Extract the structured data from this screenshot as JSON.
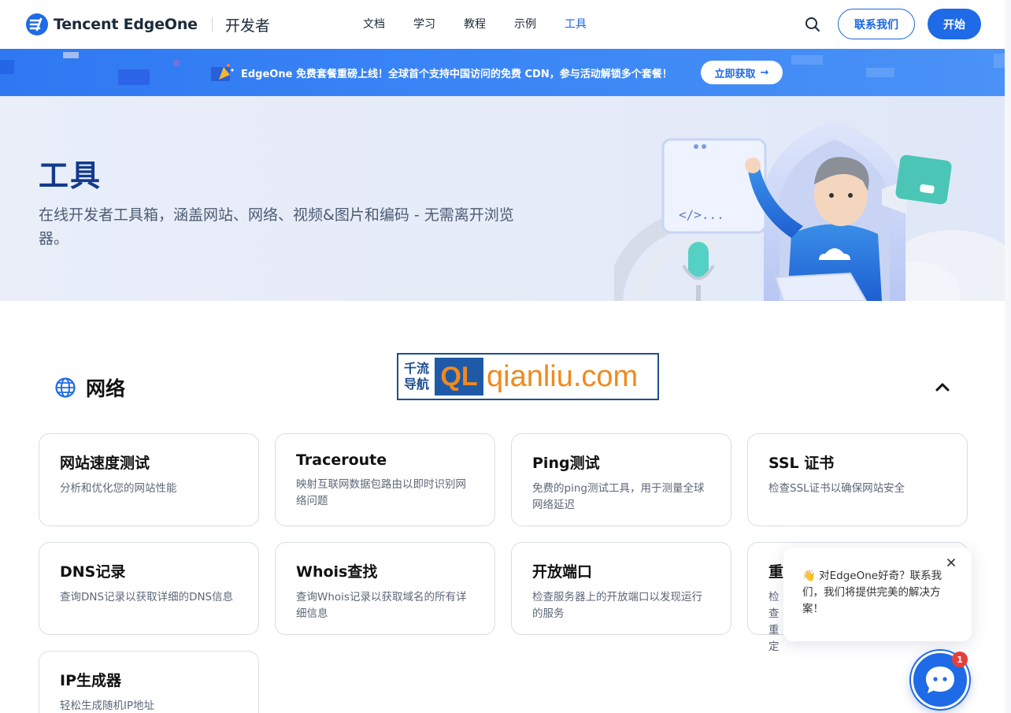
{
  "header": {
    "brand": "Tencent EdgeOne",
    "brand_sub": "开发者",
    "nav": [
      {
        "label": "文档",
        "active": false
      },
      {
        "label": "学习",
        "active": false
      },
      {
        "label": "教程",
        "active": false
      },
      {
        "label": "示例",
        "active": false
      },
      {
        "label": "工具",
        "active": true
      }
    ],
    "contact_label": "联系我们",
    "start_label": "开始"
  },
  "banner": {
    "text": "EdgeOne 免费套餐重磅上线！全球首个支持中国访问的免费 CDN，参与活动解锁多个套餐！",
    "cta": "立即获取",
    "cta_arrow": "→"
  },
  "hero": {
    "title": "工具",
    "description": "在线开发者工具箱，涵盖网站、网络、视频&图片和编码 - 无需离开浏览器。",
    "code_symbol": "</>..."
  },
  "section": {
    "title": "网络",
    "icon": "globe-icon"
  },
  "watermark": {
    "cn_line1": "千流",
    "cn_line2": "导航",
    "ql": "QL",
    "domain": "qianliu.com"
  },
  "cards": [
    {
      "title": "网站速度测试",
      "desc": "分析和优化您的网站性能"
    },
    {
      "title": "Traceroute",
      "desc": "映射互联网数据包路由以即时识别网络问题"
    },
    {
      "title": "Ping测试",
      "desc": "免费的ping测试工具，用于测量全球网络延迟"
    },
    {
      "title": "SSL 证书",
      "desc": "检查SSL证书以确保网站安全"
    },
    {
      "title": "DNS记录",
      "desc": "查询DNS记录以获取详细的DNS信息"
    },
    {
      "title": "Whois查找",
      "desc": "查询Whois记录以获取域名的所有详细信息"
    },
    {
      "title": "开放端口",
      "desc": "检查服务器上的开放端口以发现运行的服务"
    },
    {
      "title": "重",
      "desc": "检查重定"
    },
    {
      "title": "IP生成器",
      "desc": "轻松生成随机IP地址"
    }
  ],
  "chat": {
    "emoji": "👋",
    "message": "对EdgeOne好奇？联系我们，我们将提供完美的解决方案！",
    "badge": "1"
  },
  "colors": {
    "primary": "#1f6ae6",
    "hero_title": "#123a8c",
    "badge": "#e5403a"
  }
}
